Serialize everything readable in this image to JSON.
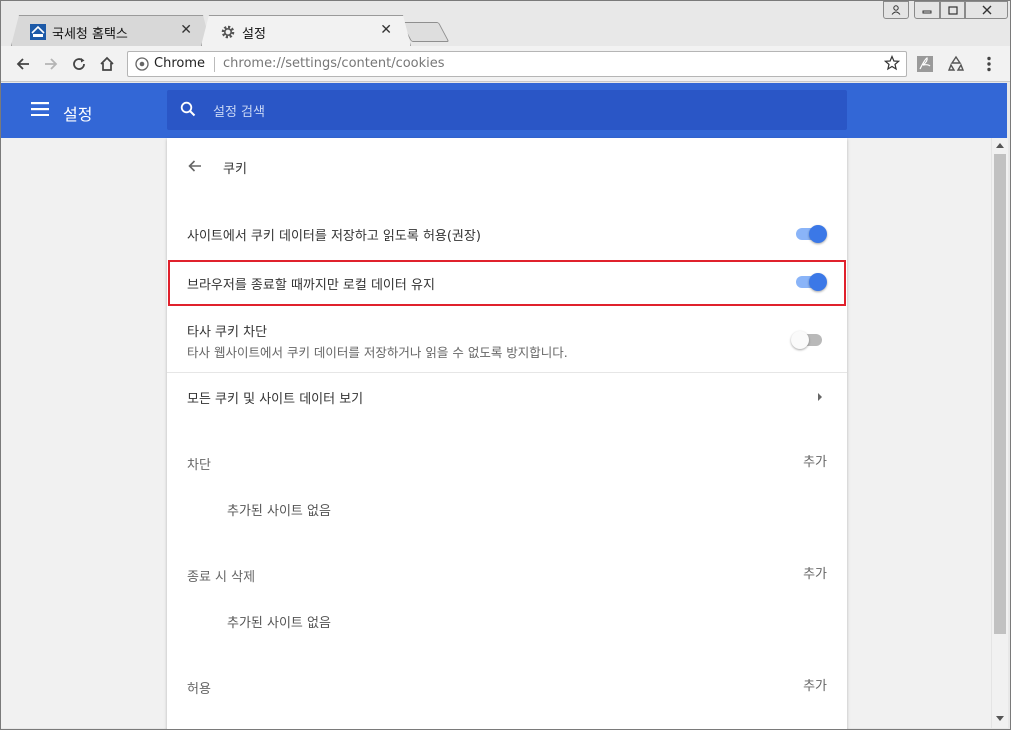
{
  "tabs": [
    {
      "label": "국세청 홈택스",
      "favicon": "hometax-logo-icon"
    },
    {
      "label": "설정",
      "favicon": "gear-icon"
    }
  ],
  "toolbar": {
    "chip": "Chrome",
    "url": "chrome://settings/content/cookies"
  },
  "header": {
    "title": "설정",
    "search_placeholder": "설정 검색"
  },
  "subpage": {
    "title": "쿠키"
  },
  "rows": {
    "allow_sites": {
      "label": "사이트에서 쿠키 데이터를 저장하고 읽도록 허용(권장)",
      "enabled": true
    },
    "keep_local": {
      "label": "브라우저를 종료할 때까지만 로컬 데이터 유지",
      "enabled": true
    },
    "block_third_party": {
      "label": "타사 쿠키 차단",
      "sub": "타사 웹사이트에서 쿠키 데이터를 저장하거나 읽을 수 없도록 방지합니다.",
      "enabled": false
    },
    "view_all": {
      "label": "모든 쿠키 및 사이트 데이터 보기"
    }
  },
  "sections": {
    "block": {
      "label": "차단",
      "add": "추가",
      "empty": "추가된 사이트 없음"
    },
    "clear_on_exit": {
      "label": "종료 시 삭제",
      "add": "추가",
      "empty": "추가된 사이트 없음"
    },
    "allow": {
      "label": "허용",
      "add": "추가"
    }
  },
  "colors": {
    "header_blue": "#3367d6",
    "search_blue": "#2a56c6",
    "toggle_on": "#3b78e7",
    "highlight_red": "#e0212c"
  }
}
